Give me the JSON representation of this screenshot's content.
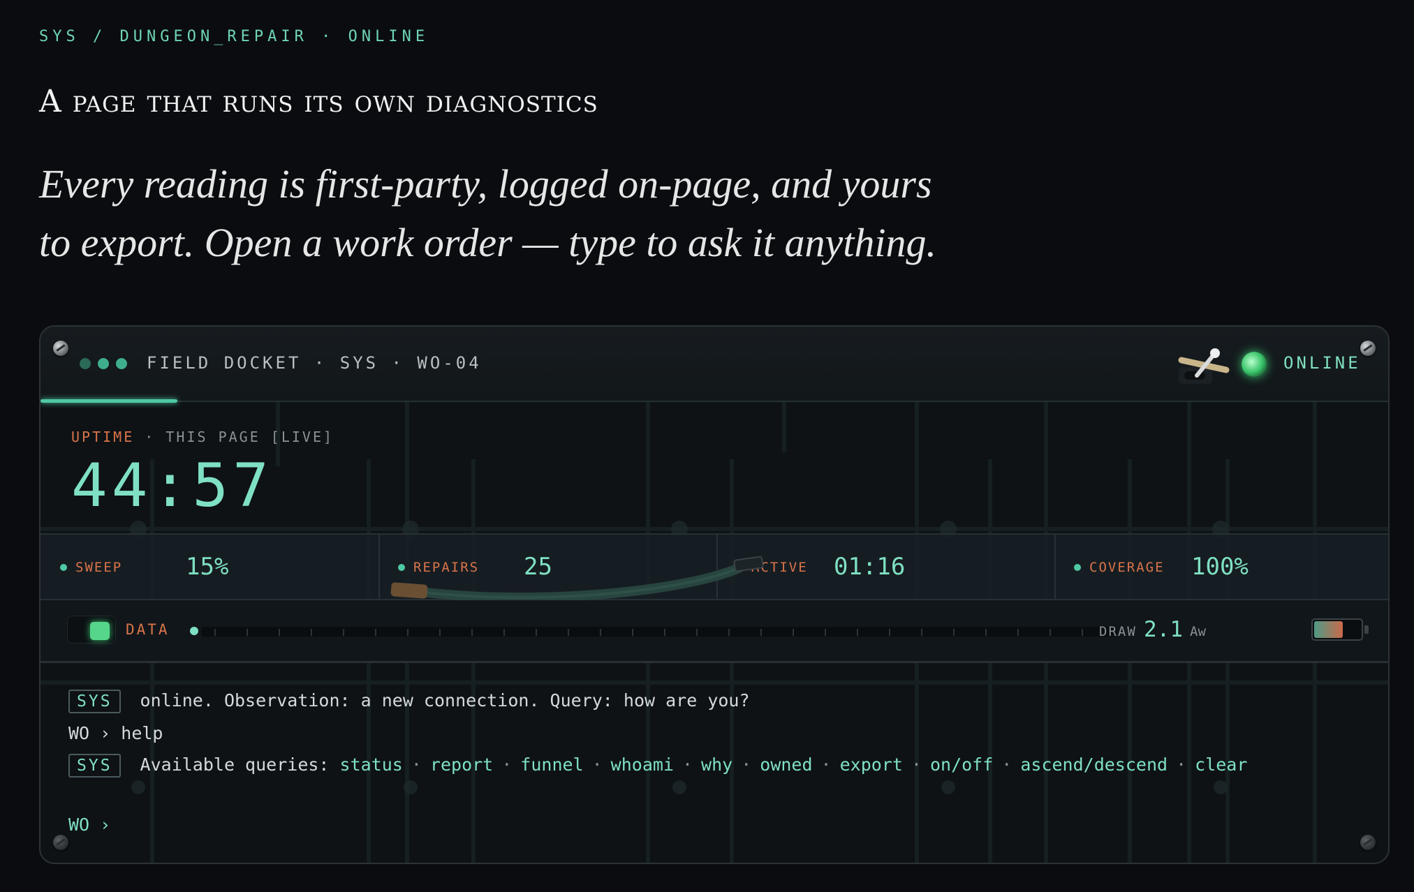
{
  "eyebrow": "SYS / DUNGEON_REPAIR · ONLINE",
  "headline": "A page that runs its own diagnostics",
  "lede": "Every reading is first-party, logged on-page, and yours to export. Open a work order — type to ask it anything.",
  "panel": {
    "title": "FIELD DOCKET · SYS · WO-04",
    "status": "ONLINE",
    "uptime": {
      "label": "UPTIME",
      "sublabel": "· THIS PAGE [LIVE]",
      "value": "44:57"
    },
    "stats": [
      {
        "label": "SWEEP",
        "value": "15%"
      },
      {
        "label": "REPAIRS",
        "value": "25"
      },
      {
        "label": "ACTIVE",
        "value": "01:16"
      },
      {
        "label": "COVERAGE",
        "value": "100%"
      }
    ],
    "data": {
      "label": "DATA",
      "draw_label": "DRAW",
      "draw_value": "2.1",
      "draw_unit": "Aw",
      "battery_level": 0.62
    },
    "terminal": {
      "lines": [
        {
          "tag": "SYS",
          "text": "online. Observation: a new connection. Query: how are you?"
        },
        {
          "prompt": "WO ›",
          "text": "help"
        },
        {
          "tag": "SYS",
          "text": "Available queries:"
        }
      ],
      "queries": [
        "status",
        "report",
        "funnel",
        "whoami",
        "why",
        "owned",
        "export",
        "on/off",
        "ascend/descend",
        "clear"
      ],
      "query_separator": "·",
      "input_prompt": "WO ›"
    }
  },
  "colors": {
    "accent": "#7fe0c3",
    "warning": "#d9744a",
    "led": "#39c46a"
  },
  "icons": [
    "status-dot-icon",
    "toggle-switch-icon",
    "led-indicator-icon",
    "screw-icon",
    "battery-icon",
    "cable-icon"
  ]
}
